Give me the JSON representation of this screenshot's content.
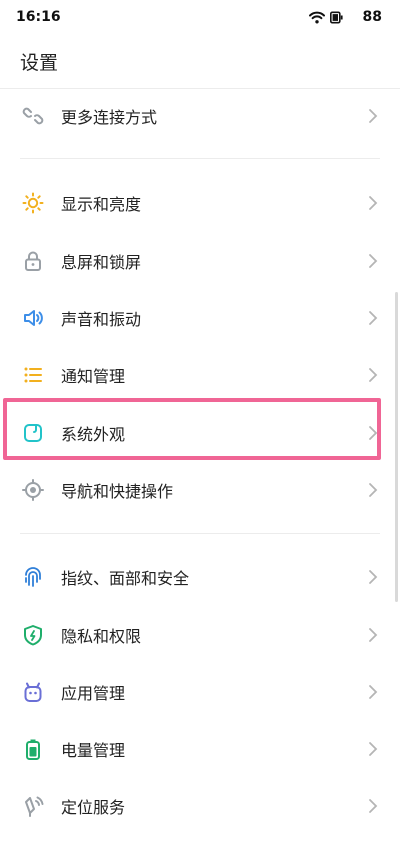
{
  "status_bar": {
    "time": "16:16",
    "battery": "88",
    "icons": [
      "wifi-icon",
      "battery-icon"
    ]
  },
  "header": {
    "title": "设置"
  },
  "colors": {
    "highlight_border": "#f06595",
    "chevron": "#b5b5b5"
  },
  "items": [
    {
      "label": "更多连接方式",
      "icon": "link-icon"
    },
    {
      "label": "显示和亮度",
      "icon": "sun-icon"
    },
    {
      "label": "息屏和锁屏",
      "icon": "lock-icon"
    },
    {
      "label": "声音和振动",
      "icon": "speaker-icon"
    },
    {
      "label": "通知管理",
      "icon": "list-icon"
    },
    {
      "label": "系统外观",
      "icon": "appearance-icon",
      "highlighted": true
    },
    {
      "label": "导航和快捷操作",
      "icon": "navigation-icon"
    },
    {
      "label": "指纹、面部和安全",
      "icon": "fingerprint-icon"
    },
    {
      "label": "隐私和权限",
      "icon": "shield-icon"
    },
    {
      "label": "应用管理",
      "icon": "android-icon"
    },
    {
      "label": "电量管理",
      "icon": "battery-manage-icon"
    },
    {
      "label": "定位服务",
      "icon": "location-icon"
    }
  ]
}
